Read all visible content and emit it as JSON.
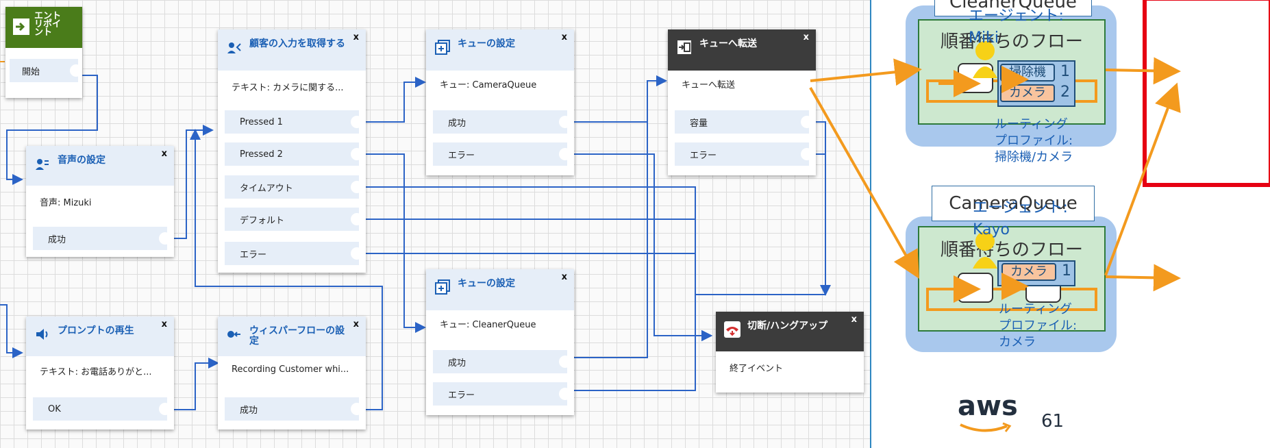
{
  "entry": {
    "title": "エントリポイント",
    "start": "開始"
  },
  "voice": {
    "title": "音声の設定",
    "desc": "音声: Mizuki",
    "success": "成功"
  },
  "input": {
    "title": "顧客の入力を取得する",
    "desc": "テキスト: カメラに関する...",
    "branches": [
      "Pressed 1",
      "Pressed 2",
      "タイムアウト",
      "デフォルト",
      "エラー"
    ]
  },
  "queue1": {
    "title": "キューの設定",
    "desc": "キュー: CameraQueue",
    "success": "成功",
    "error": "エラー"
  },
  "transfer": {
    "title": "キューへ転送",
    "desc": "キューへ転送",
    "capacity": "容量",
    "error": "エラー"
  },
  "prompt": {
    "title": "プロンプトの再生",
    "desc": "テキスト: お電話ありがと...",
    "ok": "OK"
  },
  "whisper": {
    "title": "ウィスパーフローの設定",
    "desc": "Recording Customer whi...",
    "success": "成功"
  },
  "queue2": {
    "title": "キューの設定",
    "desc": "キュー: CleanerQueue",
    "success": "成功",
    "error": "エラー"
  },
  "hangup": {
    "title": "切断/ハングアップ",
    "desc": "終了イベント"
  },
  "close_label": "x",
  "slide": {
    "cleaner_queue": "CleanerQueue",
    "camera_queue": "CameraQueue",
    "flow_title": "順番待ちのフロー",
    "agent1": {
      "label": "エージェント:",
      "name": "Miki",
      "skills": [
        {
          "name": "掃除機",
          "level": "1"
        },
        {
          "name": "カメラ",
          "level": "2"
        }
      ],
      "profile": [
        "ルーティング",
        "プロファイル:",
        "掃除機/カメラ"
      ]
    },
    "agent2": {
      "label": "エージェント:",
      "name": "Kayo",
      "skills": [
        {
          "name": "カメラ",
          "level": "1"
        }
      ],
      "profile": [
        "ルーティング",
        "プロファイル:",
        "カメラ"
      ]
    },
    "logo": "aws",
    "page_number": "61"
  },
  "colors": {
    "wire": "#2b63c6",
    "orange": "#f39a1e",
    "highlight": "#e60012",
    "block_header": "#e6eef8",
    "title_blue": "#1a5fb4",
    "entry_green": "#4a7c1a"
  }
}
